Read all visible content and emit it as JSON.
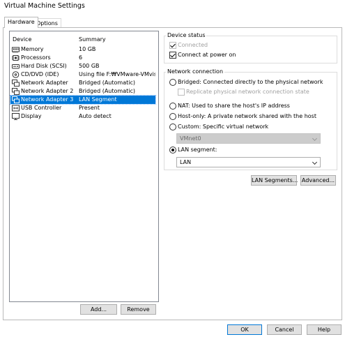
{
  "window": {
    "title": "Virtual Machine Settings"
  },
  "tabs": [
    {
      "label": "Hardware"
    },
    {
      "label": "Options"
    }
  ],
  "device_list": {
    "columns": {
      "device": "Device",
      "summary": "Summary"
    },
    "rows": [
      {
        "device": "Memory",
        "summary": "10 GB",
        "icon": "memory-icon"
      },
      {
        "device": "Processors",
        "summary": "6",
        "icon": "processor-icon"
      },
      {
        "device": "Hard Disk (SCSI)",
        "summary": "500 GB",
        "icon": "hard-disk-icon"
      },
      {
        "device": "CD/DVD (IDE)",
        "summary": "Using file F:₩VMware-VMvis...",
        "icon": "cd-dvd-icon"
      },
      {
        "device": "Network Adapter",
        "summary": "Bridged (Automatic)",
        "icon": "network-adapter-icon"
      },
      {
        "device": "Network Adapter 2",
        "summary": "Bridged (Automatic)",
        "icon": "network-adapter-icon"
      },
      {
        "device": "Network Adapter 3",
        "summary": "LAN Segment",
        "icon": "network-adapter-icon",
        "selected": true
      },
      {
        "device": "USB Controller",
        "summary": "Present",
        "icon": "usb-controller-icon"
      },
      {
        "device": "Display",
        "summary": "Auto detect",
        "icon": "display-icon"
      }
    ],
    "add_label": "Add...",
    "remove_label": "Remove"
  },
  "device_status": {
    "title": "Device status",
    "connected_label": "Connected",
    "connected_checked": true,
    "connected_enabled": false,
    "connect_at_power_on_label": "Connect at power on",
    "connect_at_power_on_checked": true
  },
  "network_connection": {
    "title": "Network connection",
    "bridged_label": "Bridged: Connected directly to the physical network",
    "replicate_label": "Replicate physical network connection state",
    "nat_label": "NAT: Used to share the host's IP address",
    "hostonly_label": "Host-only: A private network shared with the host",
    "custom_label": "Custom: Specific virtual network",
    "custom_value": "VMnet0",
    "lan_label": "LAN segment:",
    "lan_value": "LAN",
    "selected": "lan_segment"
  },
  "buttons": {
    "lan_segments": "LAN Segments...",
    "advanced": "Advanced...",
    "ok": "OK",
    "cancel": "Cancel",
    "help": "Help"
  },
  "colors": {
    "selection": "#0078d7",
    "button_face": "#e1e1e1",
    "disabled_combo": "#cccccc"
  }
}
